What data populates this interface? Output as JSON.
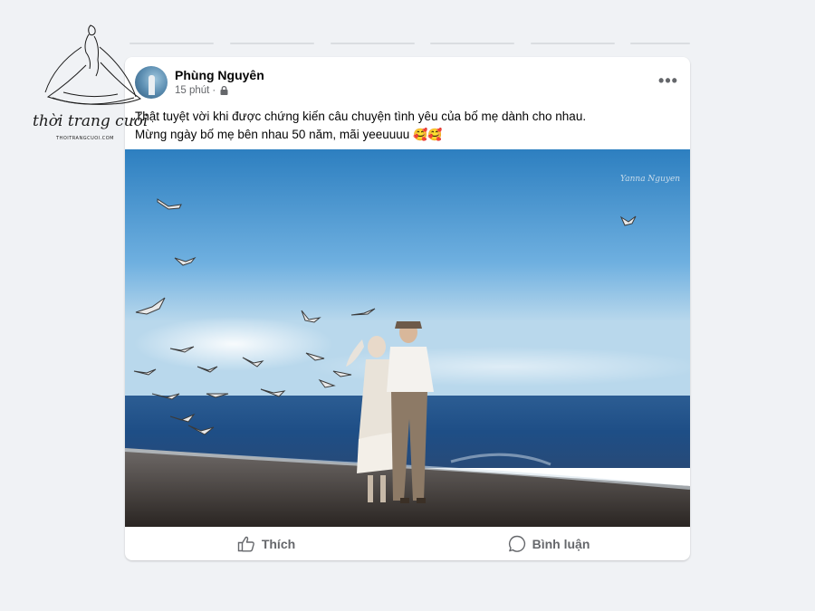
{
  "logo": {
    "brand_text": "thời trang cưới",
    "sub_text": "THOITRANGCUOI.COM",
    "icon": "bride-silhouette-icon"
  },
  "post": {
    "author": "Phùng Nguyên",
    "time": "15 phút",
    "separator": "·",
    "privacy_icon": "lock-icon",
    "more_icon": "more-options-icon",
    "more_label": "•••",
    "lines": [
      "Thật tuyệt vời khi được chứng kiến câu chuyện tình yêu của bố mẹ dành cho nhau.",
      "Mừng ngày bố mẹ bên nhau 50 năm, mãi yeeuuuu"
    ],
    "emojis": "🥰🥰",
    "photo": {
      "description_icon": "couple-beach-photo",
      "signature": "Yanna Nguyen"
    }
  },
  "actions": {
    "like": {
      "label": "Thích",
      "icon": "thumbs-up-icon"
    },
    "comment": {
      "label": "Bình luận",
      "icon": "comment-icon"
    }
  }
}
